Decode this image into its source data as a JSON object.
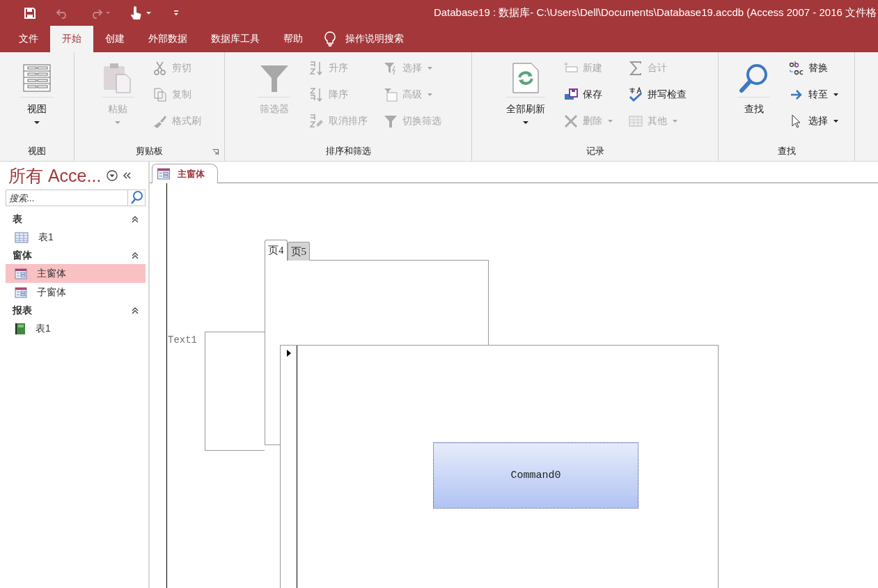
{
  "window": {
    "title": "Database19 : 数据库- C:\\Users\\Dell\\Documents\\Database19.accdb (Access 2007 - 2016 文件格"
  },
  "quick_access": [
    {
      "kind": "save",
      "disabled": false
    },
    {
      "kind": "undo",
      "disabled": true
    },
    {
      "kind": "redo",
      "disabled": true
    },
    {
      "kind": "touch",
      "disabled": false
    },
    {
      "kind": "customize",
      "disabled": false
    }
  ],
  "ribbon_tabs": [
    {
      "label": "文件",
      "selected": false
    },
    {
      "label": "开始",
      "selected": true
    },
    {
      "label": "创建",
      "selected": false
    },
    {
      "label": "外部数据",
      "selected": false
    },
    {
      "label": "数据库工具",
      "selected": false
    },
    {
      "label": "帮助",
      "selected": false
    }
  ],
  "tell_me": "操作说明搜索",
  "ribbon_groups": [
    {
      "label": "视图",
      "columns": [
        [
          {
            "label": "视图",
            "kind": "large",
            "disabled": false,
            "dropdown": true
          }
        ]
      ]
    },
    {
      "label": "剪贴板",
      "launcher": true,
      "columns": [
        [
          {
            "label": "粘贴",
            "kind": "large",
            "disabled": true,
            "dropdown": true
          }
        ],
        [
          {
            "label": "剪切",
            "kind": "small",
            "disabled": true,
            "dropdown": false
          },
          {
            "label": "复制",
            "kind": "small",
            "disabled": true,
            "dropdown": false
          },
          {
            "label": "格式刷",
            "kind": "small",
            "disabled": true,
            "dropdown": false
          }
        ]
      ]
    },
    {
      "label": "排序和筛选",
      "columns": [
        [
          {
            "label": "筛选器",
            "kind": "large",
            "disabled": true,
            "dropdown": false
          }
        ],
        [
          {
            "label": "升序",
            "kind": "small",
            "disabled": true,
            "dropdown": false
          },
          {
            "label": "降序",
            "kind": "small",
            "disabled": true,
            "dropdown": false
          },
          {
            "label": "取消排序",
            "kind": "small",
            "disabled": true,
            "dropdown": false
          }
        ],
        [
          {
            "label": "选择",
            "kind": "small",
            "disabled": true,
            "dropdown": true
          },
          {
            "label": "高级",
            "kind": "small",
            "disabled": true,
            "dropdown": true
          },
          {
            "label": "切换筛选",
            "kind": "small",
            "disabled": true,
            "dropdown": false
          }
        ]
      ]
    },
    {
      "label": "记录",
      "columns": [
        [
          {
            "label": "全部刷新",
            "kind": "large",
            "disabled": false,
            "dropdown": true
          }
        ],
        [
          {
            "label": "新建",
            "kind": "small",
            "disabled": true,
            "dropdown": false
          },
          {
            "label": "保存",
            "kind": "small",
            "disabled": false,
            "dropdown": false
          },
          {
            "label": "删除",
            "kind": "small",
            "disabled": true,
            "dropdown": true
          }
        ],
        [
          {
            "label": "合计",
            "kind": "small",
            "disabled": true,
            "dropdown": false
          },
          {
            "label": "拼写检查",
            "kind": "small",
            "disabled": false,
            "dropdown": false
          },
          {
            "label": "其他",
            "kind": "small",
            "disabled": true,
            "dropdown": true
          }
        ]
      ]
    },
    {
      "label": "查找",
      "columns": [
        [
          {
            "label": "查找",
            "kind": "large",
            "disabled": false,
            "dropdown": false
          }
        ],
        [
          {
            "label": "替换",
            "kind": "small",
            "disabled": false,
            "dropdown": false
          },
          {
            "label": "转至",
            "kind": "small",
            "disabled": false,
            "dropdown": true
          },
          {
            "label": "选择",
            "kind": "small",
            "disabled": false,
            "dropdown": true
          }
        ]
      ]
    }
  ],
  "nav_pane": {
    "title": "所有 Acce...",
    "search": {
      "placeholder": "搜索..."
    },
    "groups": [
      {
        "label": "表",
        "expanded": true,
        "items": [
          {
            "label": "表1",
            "kind": "table",
            "selected": false
          }
        ]
      },
      {
        "label": "窗体",
        "expanded": true,
        "items": [
          {
            "label": "主窗体",
            "kind": "form",
            "selected": true
          },
          {
            "label": "子窗体",
            "kind": "form",
            "selected": false
          }
        ]
      },
      {
        "label": "报表",
        "expanded": true,
        "items": [
          {
            "label": "表1",
            "kind": "report",
            "selected": false
          }
        ]
      }
    ]
  },
  "document_tabs": [
    {
      "label": "主窗体",
      "kind": "form",
      "selected": true
    }
  ],
  "form_design": {
    "label": "Text1",
    "tab_control": {
      "tabs": [
        {
          "label": "页4",
          "selected": true
        },
        {
          "label": "页5",
          "selected": false
        }
      ]
    },
    "command_button": "Command0"
  }
}
